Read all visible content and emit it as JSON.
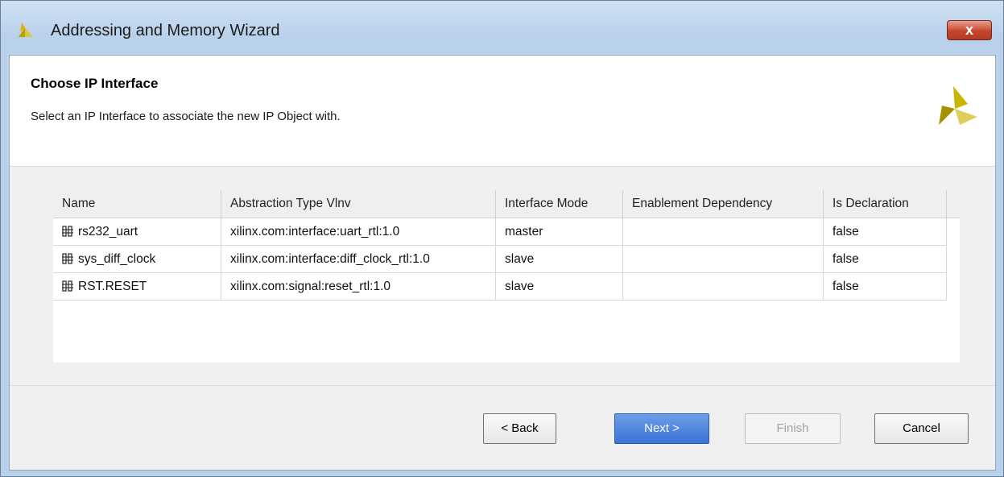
{
  "window": {
    "title": "Addressing and Memory Wizard",
    "close_label": "x"
  },
  "header": {
    "title": "Choose IP Interface",
    "subtitle": "Select an IP Interface to associate the new IP Object with."
  },
  "table": {
    "columns": [
      "Name",
      "Abstraction Type Vlnv",
      "Interface Mode",
      "Enablement Dependency",
      "Is Declaration"
    ],
    "rows": [
      {
        "name": "rs232_uart",
        "vlnv": "xilinx.com:interface:uart_rtl:1.0",
        "mode": "master",
        "dependency": "",
        "declaration": "false"
      },
      {
        "name": "sys_diff_clock",
        "vlnv": "xilinx.com:interface:diff_clock_rtl:1.0",
        "mode": "slave",
        "dependency": "",
        "declaration": "false"
      },
      {
        "name": "RST.RESET",
        "vlnv": "xilinx.com:signal:reset_rtl:1.0",
        "mode": "slave",
        "dependency": "",
        "declaration": "false"
      }
    ]
  },
  "buttons": {
    "back": "< Back",
    "next": "Next >",
    "finish": "Finish",
    "cancel": "Cancel"
  },
  "icons": {
    "app": "xilinx-logo-icon",
    "row": "interface-icon"
  },
  "colors": {
    "accent": "#3b73d6",
    "logo_yellow": "#b8a000"
  }
}
